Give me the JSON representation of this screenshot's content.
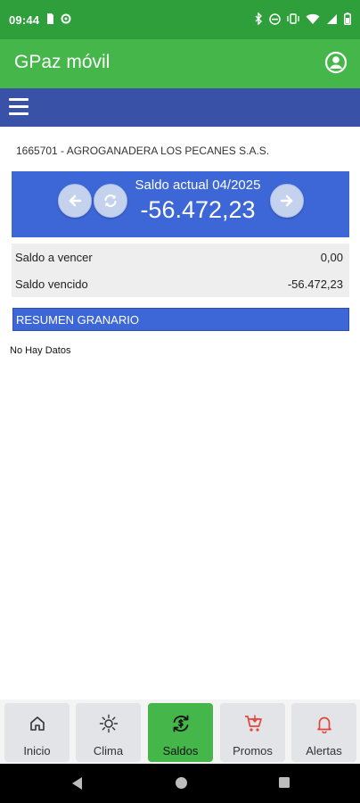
{
  "status_bar": {
    "time": "09:44",
    "left_icons": [
      "sim-card-icon",
      "settings-icon"
    ],
    "right_icons": [
      "bluetooth-icon",
      "do-not-disturb-icon",
      "vibrate-icon",
      "wifi-icon",
      "signal-icon",
      "battery-icon"
    ]
  },
  "app_bar": {
    "title": "GPaz móvil",
    "account_icon": "account-circle-icon"
  },
  "nav": {
    "menu_icon": "hamburger-menu-icon"
  },
  "company": "1665701 - AGROGANADERA LOS PECANES S.A.S.",
  "balance": {
    "label": "Saldo actual 04/2025",
    "amount": "-56.472,23",
    "prev_icon": "arrow-left-icon",
    "refresh_icon": "refresh-icon",
    "next_icon": "arrow-right-icon"
  },
  "summary": [
    {
      "label": "Saldo a vencer",
      "value": "0,00"
    },
    {
      "label": "Saldo vencido",
      "value": "-56.472,23"
    }
  ],
  "section": {
    "title": "RESUMEN GRANARIO",
    "empty_text": "No Hay Datos"
  },
  "tabs": [
    {
      "label": "Inicio",
      "icon": "home-icon",
      "active": false
    },
    {
      "label": "Clima",
      "icon": "sun-icon",
      "active": false
    },
    {
      "label": "Saldos",
      "icon": "sync-dollar-icon",
      "active": true
    },
    {
      "label": "Promos",
      "icon": "cart-icon",
      "active": false
    },
    {
      "label": "Alertas",
      "icon": "bell-icon",
      "active": false
    }
  ],
  "colors": {
    "status_bar": "#2e9f3a",
    "app_bar": "#45b649",
    "nav_bar": "#3a51a8",
    "accent_blue": "#3d67d6",
    "active_tab": "#45b649",
    "alert_red": "#e2463f"
  }
}
